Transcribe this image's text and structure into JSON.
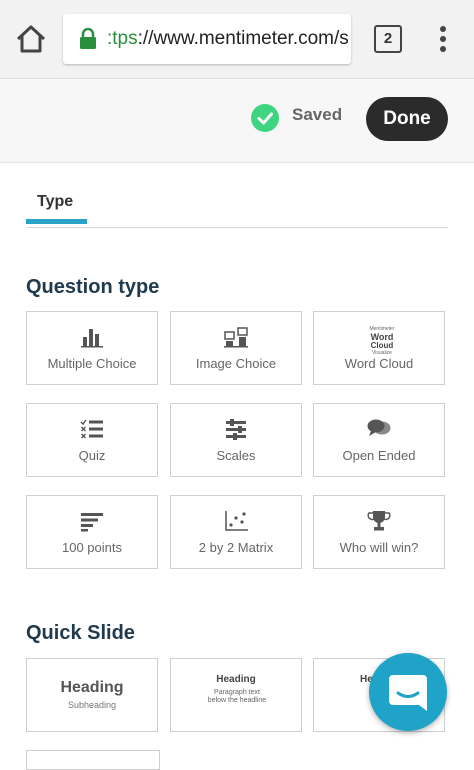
{
  "browser": {
    "url_scheme": ":tps",
    "url_rest": "://www.mentimeter.com/s",
    "tab_count": "2"
  },
  "header": {
    "saved_label": "Saved",
    "done_label": "Done"
  },
  "tabs": [
    {
      "label": "Type"
    }
  ],
  "question_type": {
    "title": "Question type",
    "items": [
      {
        "label": "Multiple Choice",
        "icon": "bar-chart-icon"
      },
      {
        "label": "Image Choice",
        "icon": "image-choice-icon"
      },
      {
        "label": "Word Cloud",
        "icon": "word-cloud-icon"
      },
      {
        "label": "Quiz",
        "icon": "quiz-icon"
      },
      {
        "label": "Scales",
        "icon": "sliders-icon"
      },
      {
        "label": "Open Ended",
        "icon": "speech-bubbles-icon"
      },
      {
        "label": "100 points",
        "icon": "bars-list-icon"
      },
      {
        "label": "2 by 2 Matrix",
        "icon": "scatter-matrix-icon"
      },
      {
        "label": "Who will win?",
        "icon": "trophy-icon"
      }
    ]
  },
  "word_cloud_icon_text": [
    "Mentimeter",
    "Word",
    "Cloud",
    "Visualize"
  ],
  "quick_slide": {
    "title": "Quick Slide",
    "items": [
      {
        "heading": "Heading",
        "subheading": "Subheading"
      },
      {
        "heading": "Heading",
        "paragraph": "Paragraph text below the headline"
      },
      {
        "heading": "He"
      }
    ]
  },
  "colors": {
    "accent": "#2aa3c9",
    "saved_green": "#3fd47f",
    "done_bg": "#2b2b2b",
    "title_navy": "#203b4e"
  }
}
